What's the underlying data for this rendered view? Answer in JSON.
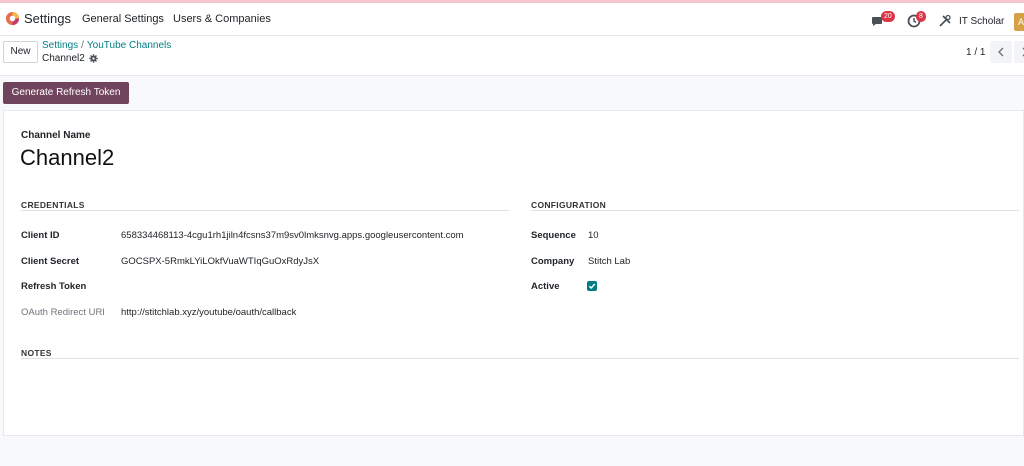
{
  "navbar": {
    "app_name": "Settings",
    "menus": [
      "General Settings",
      "Users & Companies"
    ],
    "messages_badge": "20",
    "activities_badge": "8",
    "user_name": "IT Scholar",
    "avatar_initial": "A"
  },
  "control_panel": {
    "new_label": "New",
    "breadcrumb": [
      "Settings",
      "YouTube Channels"
    ],
    "breadcrumb_separator": "/",
    "record_name": "Channel2",
    "pager": "1 / 1"
  },
  "actions": {
    "generate_refresh_token": "Generate Refresh Token"
  },
  "form": {
    "channel_name_label": "Channel Name",
    "channel_name": "Channel2",
    "credentials": {
      "title": "CREDENTIALS",
      "client_id_label": "Client ID",
      "client_id": "658334468113-4cgu1rh1jiln4fcsns37m9sv0lmksnvg.apps.googleusercontent.com",
      "client_secret_label": "Client Secret",
      "client_secret": "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",
      "refresh_token_label": "Refresh Token",
      "refresh_token": "",
      "oauth_redirect_label": "OAuth Redirect URI",
      "oauth_redirect": "http://stitchlab.xyz/youtube/oauth/callback"
    },
    "configuration": {
      "title": "CONFIGURATION",
      "sequence_label": "Sequence",
      "sequence": "10",
      "company_label": "Company",
      "company": "Stitch Lab",
      "active_label": "Active",
      "active": true
    },
    "notes": {
      "title": "NOTES"
    }
  },
  "colors": {
    "primary_button": "#71445d",
    "link": "#017e84",
    "badge": "#dc3545",
    "checkbox": "#017e84"
  },
  "icons": [
    "odoo-logo-icon",
    "chat-icon",
    "clock-icon",
    "tools-icon",
    "gear-icon",
    "chevron-left-icon",
    "chevron-right-icon",
    "check-icon"
  ]
}
